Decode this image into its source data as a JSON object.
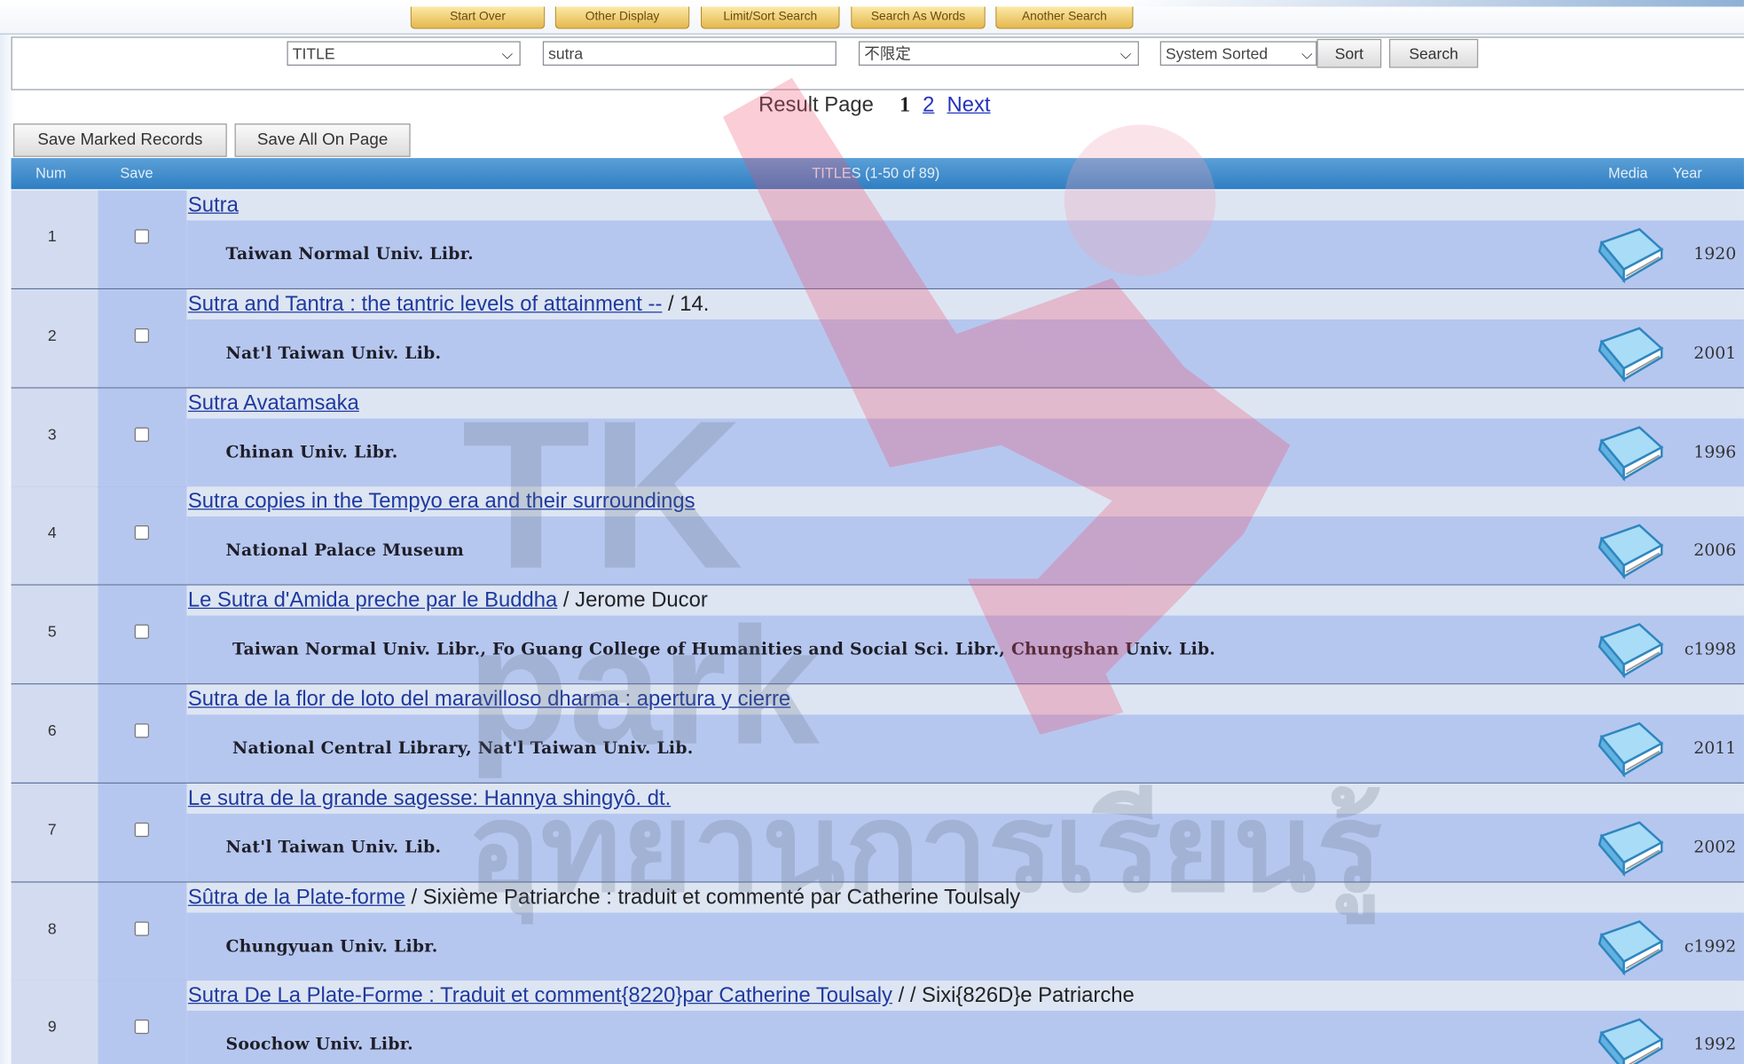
{
  "nav_buttons": [
    "Start Over",
    "Other Display",
    "Limit/Sort Search",
    "Search As Words",
    "Another Search"
  ],
  "search": {
    "field_select": "TITLE",
    "query": "sutra",
    "scope_select": "不限定",
    "sort_select": "System Sorted",
    "sort_button": "Sort",
    "search_button": "Search"
  },
  "pager": {
    "label": "Result Page",
    "current": "1",
    "page2": "2",
    "next": "Next"
  },
  "save_buttons": {
    "marked": "Save Marked Records",
    "all": "Save All On Page"
  },
  "table_header": {
    "num": "Num",
    "save": "Save",
    "titles": "TITLES (1-50 of 89)",
    "media": "Media",
    "year": "Year"
  },
  "records": [
    {
      "num": "1",
      "title_link": "Sutra",
      "title_rest": "",
      "library": "Taiwan Normal Univ. Libr.",
      "year": "1920"
    },
    {
      "num": "2",
      "title_link": "Sutra and Tantra : the tantric levels of attainment --",
      "title_rest": " / 14.",
      "library": "Nat'l Taiwan Univ. Lib.",
      "year": "2001"
    },
    {
      "num": "3",
      "title_link": "Sutra Avatamsaka",
      "title_rest": "",
      "library": "Chinan Univ. Libr.",
      "year": "1996"
    },
    {
      "num": "4",
      "title_link": "Sutra copies in the Tempyo era and their surroundings",
      "title_rest": "",
      "library": "National Palace Museum",
      "year": "2006"
    },
    {
      "num": "5",
      "title_link": "Le Sutra d'Amida preche par le Buddha",
      "title_rest": " / Jerome Ducor",
      "library": "Taiwan Normal Univ. Libr., Fo Guang College of Humanities and Social Sci. Libr., Chungshan Univ. Lib.",
      "year": "c1998"
    },
    {
      "num": "6",
      "title_link": "Sutra de la flor de loto del maravilloso dharma : apertura y cierre",
      "title_rest": "",
      "library": "National Central Library, Nat'l Taiwan Univ. Lib.",
      "year": "2011"
    },
    {
      "num": "7",
      "title_link": "Le sutra de la grande sagesse: Hannya shingyô. dt.",
      "title_rest": "",
      "library": "Nat'l Taiwan Univ. Lib.",
      "year": "2002"
    },
    {
      "num": "8",
      "title_link": "Sûtra de la Plate-forme",
      "title_rest": " / Sixième Patriarche : traduit et commenté par Catherine Toulsaly",
      "library": "Chungyuan Univ. Libr.",
      "year": "c1992"
    },
    {
      "num": "9",
      "title_link": "Sutra De La Plate-Forme : Traduit et comment{8220}par Catherine Toulsaly",
      "title_rest": " / / Sixi{826D}e Patriarche",
      "library": "Soochow Univ. Libr.",
      "year": "1992"
    }
  ],
  "watermark": {
    "text1": "TK",
    "text2": "park",
    "text3": "อุทยานการเรียนรู้"
  },
  "colors": {
    "header": "#2f7fc4",
    "link": "#1f3a9e",
    "row_light": "#dde5f3",
    "row_dark": "#b6c7ef",
    "nav_gold": "#e5b84e"
  }
}
